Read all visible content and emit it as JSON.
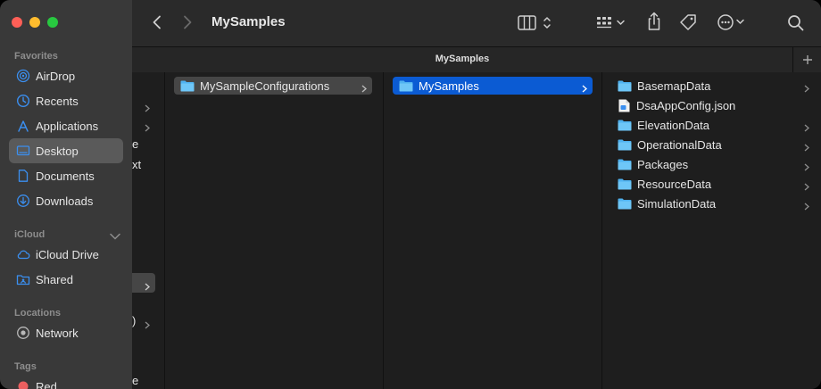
{
  "window": {
    "title": "MySamples"
  },
  "tab": {
    "title": "MySamples"
  },
  "sidebar": {
    "favorites_header": "Favorites",
    "favorites": [
      {
        "label": "AirDrop",
        "icon": "airdrop-icon"
      },
      {
        "label": "Recents",
        "icon": "clock-icon"
      },
      {
        "label": "Applications",
        "icon": "applications-icon"
      },
      {
        "label": "Desktop",
        "icon": "desktop-icon",
        "selected": true
      },
      {
        "label": "Documents",
        "icon": "document-icon"
      },
      {
        "label": "Downloads",
        "icon": "download-icon"
      }
    ],
    "icloud_header": "iCloud",
    "icloud": [
      {
        "label": "iCloud Drive",
        "icon": "cloud-icon"
      },
      {
        "label": "Shared",
        "icon": "shared-folder-icon"
      }
    ],
    "locations_header": "Locations",
    "locations": [
      {
        "label": "Network",
        "icon": "network-icon"
      }
    ],
    "tags_header": "Tags",
    "tags": [
      {
        "label": "Red",
        "color": "#ec5f5f"
      }
    ]
  },
  "columns": {
    "partial_fragments": [
      "e",
      "xt",
      ")",
      "e"
    ],
    "col2": [
      {
        "name": "MySampleConfigurations",
        "type": "folder"
      }
    ],
    "col3": [
      {
        "name": "MySamples",
        "type": "folder"
      }
    ],
    "col4": [
      {
        "name": "BasemapData",
        "type": "folder"
      },
      {
        "name": "DsaAppConfig.json",
        "type": "file"
      },
      {
        "name": "ElevationData",
        "type": "folder"
      },
      {
        "name": "OperationalData",
        "type": "folder"
      },
      {
        "name": "Packages",
        "type": "folder"
      },
      {
        "name": "ResourceData",
        "type": "folder"
      },
      {
        "name": "SimulationData",
        "type": "folder"
      }
    ]
  },
  "colors": {
    "accent": "#0b5bd3",
    "folder": "#4fb2f0",
    "sidebar_icon": "#3b8ff0"
  }
}
